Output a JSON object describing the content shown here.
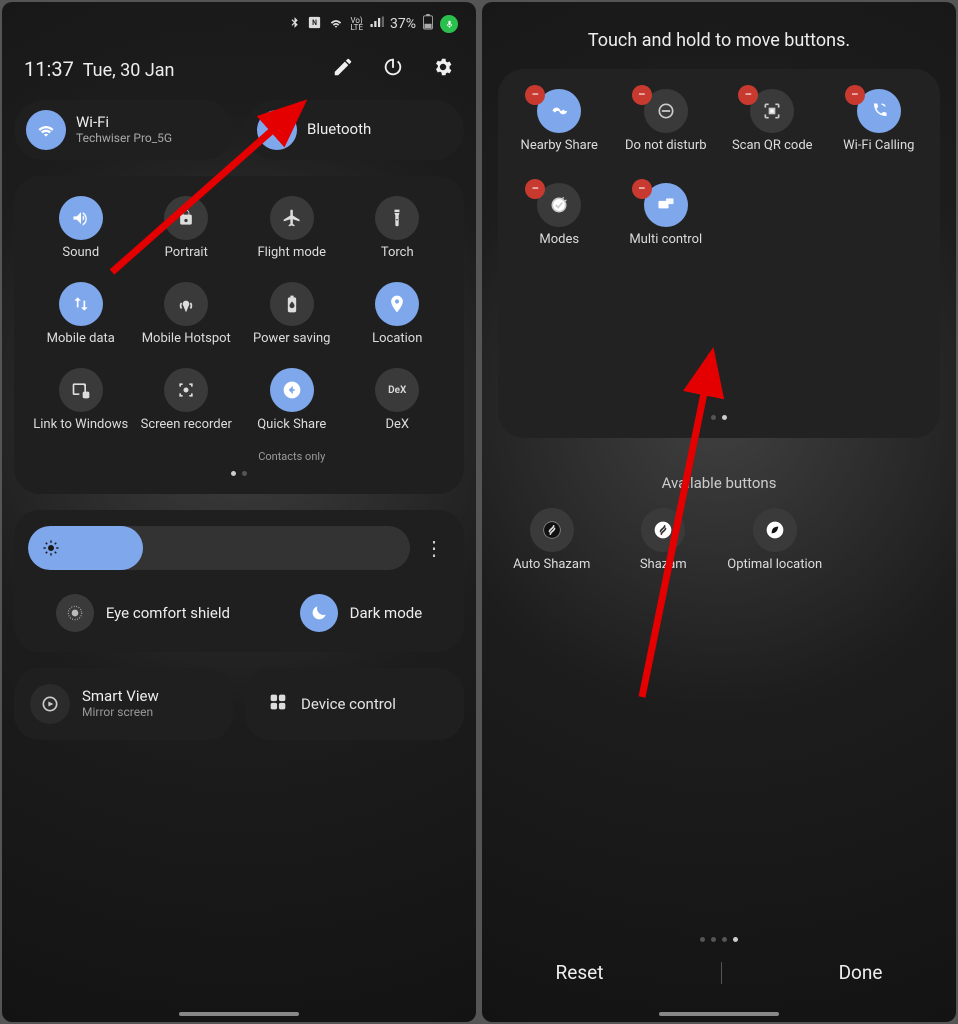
{
  "left": {
    "status": {
      "battery_text": "37%"
    },
    "header": {
      "time": "11:37",
      "date": "Tue, 30 Jan"
    },
    "wifi": {
      "title": "Wi-Fi",
      "sub": "Techwiser Pro_5G"
    },
    "bluetooth": {
      "title": "Bluetooth"
    },
    "tiles": [
      {
        "label": "Sound"
      },
      {
        "label": "Portrait"
      },
      {
        "label": "Flight mode"
      },
      {
        "label": "Torch"
      },
      {
        "label": "Mobile data"
      },
      {
        "label": "Mobile Hotspot"
      },
      {
        "label": "Power saving"
      },
      {
        "label": "Location"
      },
      {
        "label": "Link to Windows"
      },
      {
        "label": "Screen recorder"
      },
      {
        "label": "Quick Share",
        "sub": "Contacts only"
      },
      {
        "label": "DeX"
      }
    ],
    "eye": "Eye comfort shield",
    "dark": "Dark mode",
    "smartview": {
      "title": "Smart View",
      "sub": "Mirror screen"
    },
    "devicectl": "Device control"
  },
  "right": {
    "title": "Touch and hold to move buttons.",
    "tiles": [
      {
        "label": "Nearby Share"
      },
      {
        "label": "Do not disturb"
      },
      {
        "label": "Scan QR code"
      },
      {
        "label": "Wi-Fi Calling"
      },
      {
        "label": "Modes"
      },
      {
        "label": "Multi control"
      }
    ],
    "avail_title": "Available buttons",
    "avail": [
      {
        "label": "Auto Shazam"
      },
      {
        "label": "Shazam"
      },
      {
        "label": "Optimal location"
      }
    ],
    "reset": "Reset",
    "done": "Done"
  }
}
